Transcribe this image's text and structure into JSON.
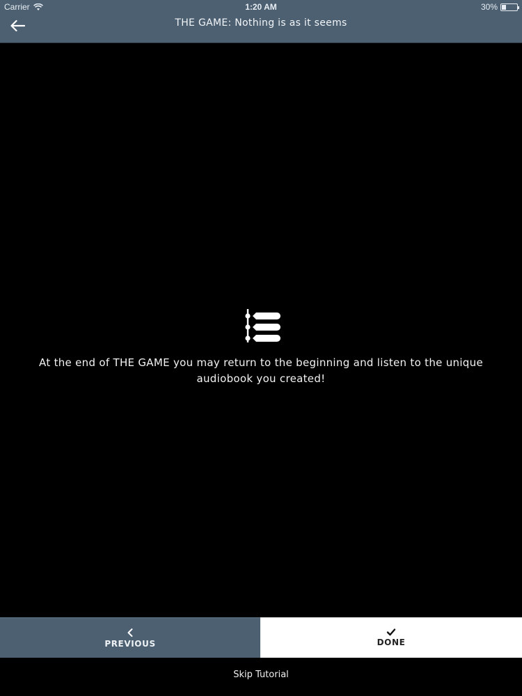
{
  "status_bar": {
    "carrier": "Carrier",
    "time": "1:20 AM",
    "battery": "30%",
    "battery_level": 0.3,
    "wifi_icon": "wifi-icon",
    "battery_icon": "battery-icon"
  },
  "header": {
    "title": "THE GAME: Nothing is as it seems",
    "back_icon": "arrow-left-icon"
  },
  "main": {
    "icon": "list-timeline-icon",
    "message": "At the end of THE GAME you may return to the beginning and listen to the unique audiobook you created!"
  },
  "footer": {
    "previous_label": "PREVIOUS",
    "previous_icon": "chevron-left-icon",
    "done_label": "DONE",
    "done_icon": "checkmark-icon",
    "skip_label": "Skip Tutorial"
  },
  "colors": {
    "header_bg": "#4c6072",
    "background": "#000000",
    "done_bg": "#ffffff"
  }
}
